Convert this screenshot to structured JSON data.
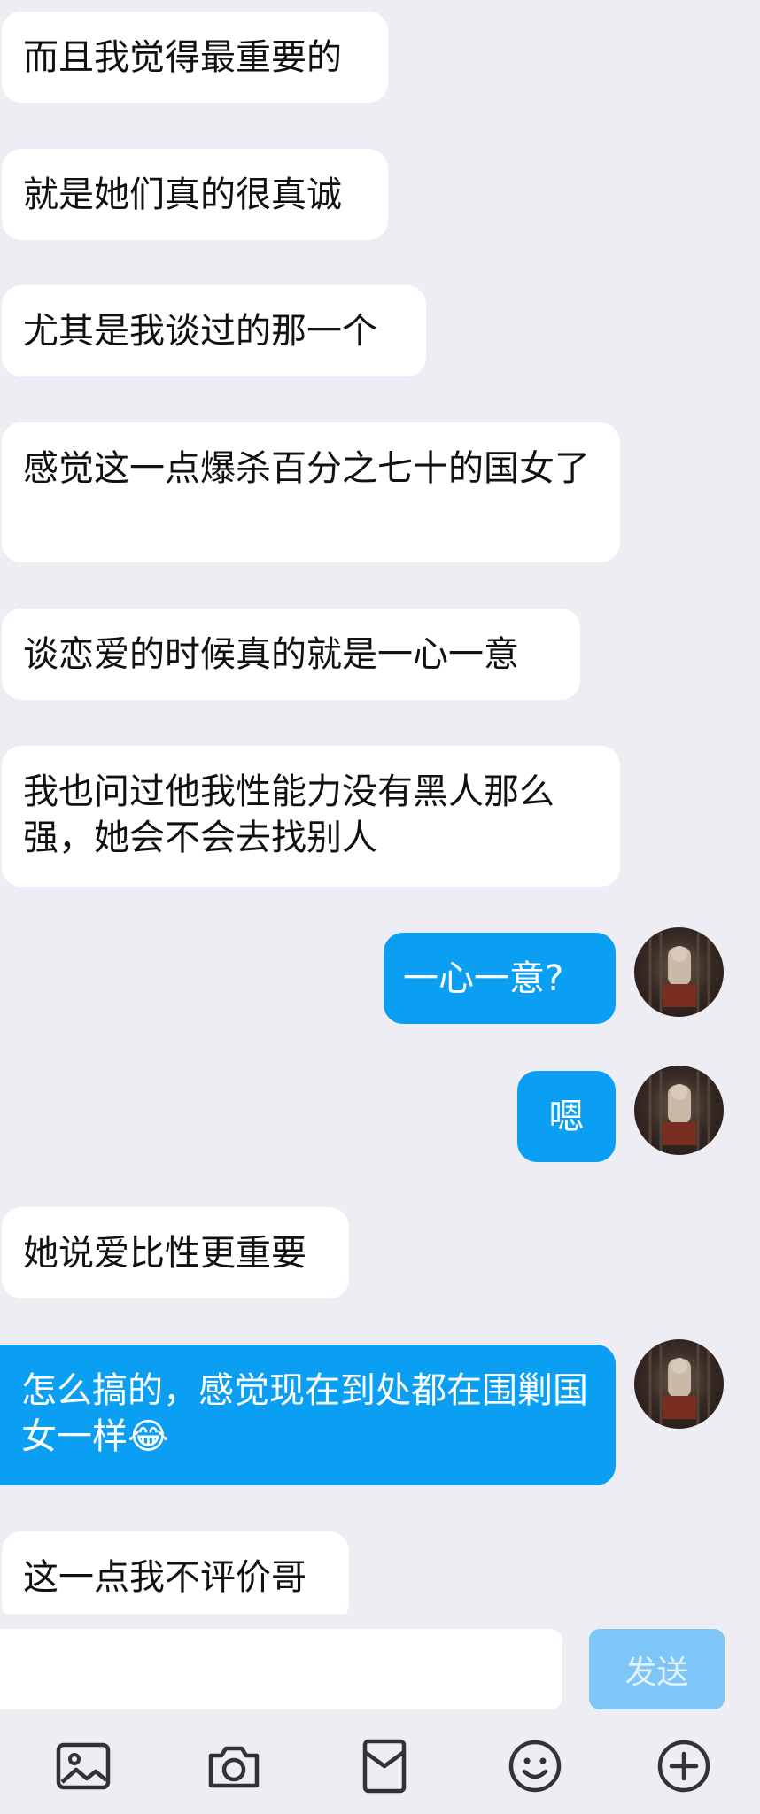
{
  "messages": [
    {
      "side": "in",
      "text": "而且我觉得最重要的"
    },
    {
      "side": "in",
      "text": "就是她们真的很真诚"
    },
    {
      "side": "in",
      "text": "尤其是我谈过的那一个"
    },
    {
      "side": "in",
      "text": "感觉这一点爆杀百分之七十的国女了"
    },
    {
      "side": "in",
      "text": "谈恋爱的时候真的就是一心一意"
    },
    {
      "side": "in",
      "text": "我也问过他我性能力没有黑人那么强，她会不会去找别人"
    },
    {
      "side": "out",
      "text": "一心一意?"
    },
    {
      "side": "out",
      "text": "嗯"
    },
    {
      "side": "in",
      "text": "她说爱比性更重要"
    },
    {
      "side": "out",
      "text": "怎么搞的，感觉现在到处都在围剿国女一样😂"
    },
    {
      "side": "in",
      "text": "这一点我不评价哥"
    }
  ],
  "input": {
    "value": "",
    "placeholder": ""
  },
  "send_button": {
    "label": "发送"
  },
  "toolbar": {
    "items": [
      {
        "icon": "image-icon"
      },
      {
        "icon": "camera-icon"
      },
      {
        "icon": "red-packet-icon"
      },
      {
        "icon": "emoji-icon"
      },
      {
        "icon": "plus-icon"
      }
    ]
  },
  "colors": {
    "background": "#ededf3",
    "incoming_bubble": "#ffffff",
    "outgoing_bubble": "#0a9ff2",
    "send_button_disabled": "#7ec6f7",
    "icon": "#333333"
  }
}
